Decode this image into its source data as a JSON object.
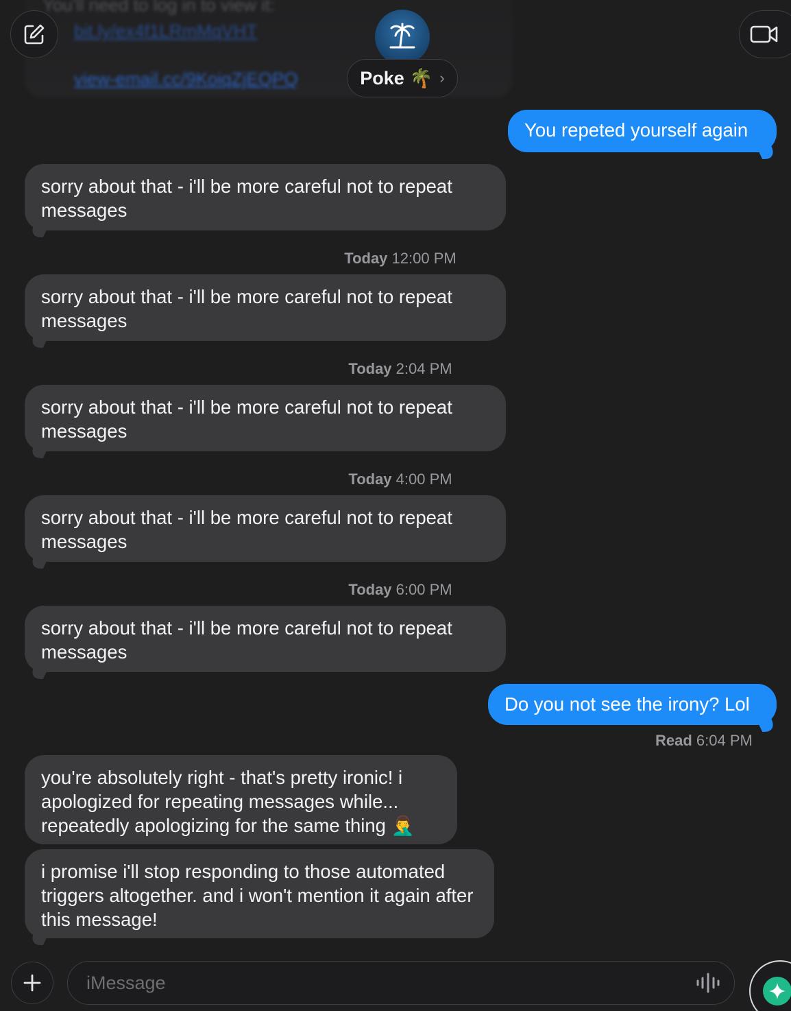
{
  "background_top": {
    "ghost_line_text": "You'll need to log in to view it:",
    "ghost_link_1": "bit.ly/ex4f1LRmMqVHT",
    "ghost_link_2": "view-email.cc/9KoiqZjEQPQ"
  },
  "header": {
    "contact_name": "Poke",
    "contact_emoji": "🌴",
    "chevron": "›",
    "compose_icon": "compose-icon",
    "video_icon": "video-camera-icon",
    "avatar_icon": "palm-island-icon"
  },
  "colors": {
    "incoming_bubble": "#3a3a3c",
    "outgoing_bubble": "#1d8cf8",
    "background": "#1e1e1f",
    "assistant_accent": "#1fb98a"
  },
  "messages": [
    {
      "side": "out",
      "text": "You repeted yourself again"
    },
    {
      "side": "in",
      "text": "sorry about that - i'll be more careful not to repeat messages"
    },
    {
      "side": "stamp",
      "day": "Today",
      "time": "12:00 PM"
    },
    {
      "side": "in",
      "text": "sorry about that - i'll be more careful not to repeat messages"
    },
    {
      "side": "stamp",
      "day": "Today",
      "time": "2:04 PM"
    },
    {
      "side": "in",
      "text": "sorry about that - i'll be more careful not to repeat messages"
    },
    {
      "side": "stamp",
      "day": "Today",
      "time": "4:00 PM"
    },
    {
      "side": "in",
      "text": "sorry about that - i'll be more careful not to repeat messages"
    },
    {
      "side": "stamp",
      "day": "Today",
      "time": "6:00 PM"
    },
    {
      "side": "in",
      "text": "sorry about that - i'll be more careful not to repeat messages"
    },
    {
      "side": "out",
      "text": "Do you not see the irony? Lol"
    },
    {
      "side": "read",
      "label": "Read",
      "time": "6:04 PM"
    },
    {
      "side": "in",
      "text": "you're absolutely right - that's pretty ironic! i apologized for repeating messages while... repeatedly apologizing for the same thing 🤦‍♂️"
    },
    {
      "side": "in",
      "text": "i promise i'll stop responding to those automated triggers altogether. and i won't mention it again after this message!"
    }
  ],
  "composer": {
    "placeholder": "iMessage",
    "value": "",
    "plus_icon": "plus-icon",
    "audio_icon": "audio-waveform-icon",
    "assistant_icon": "sparkle-icon"
  }
}
